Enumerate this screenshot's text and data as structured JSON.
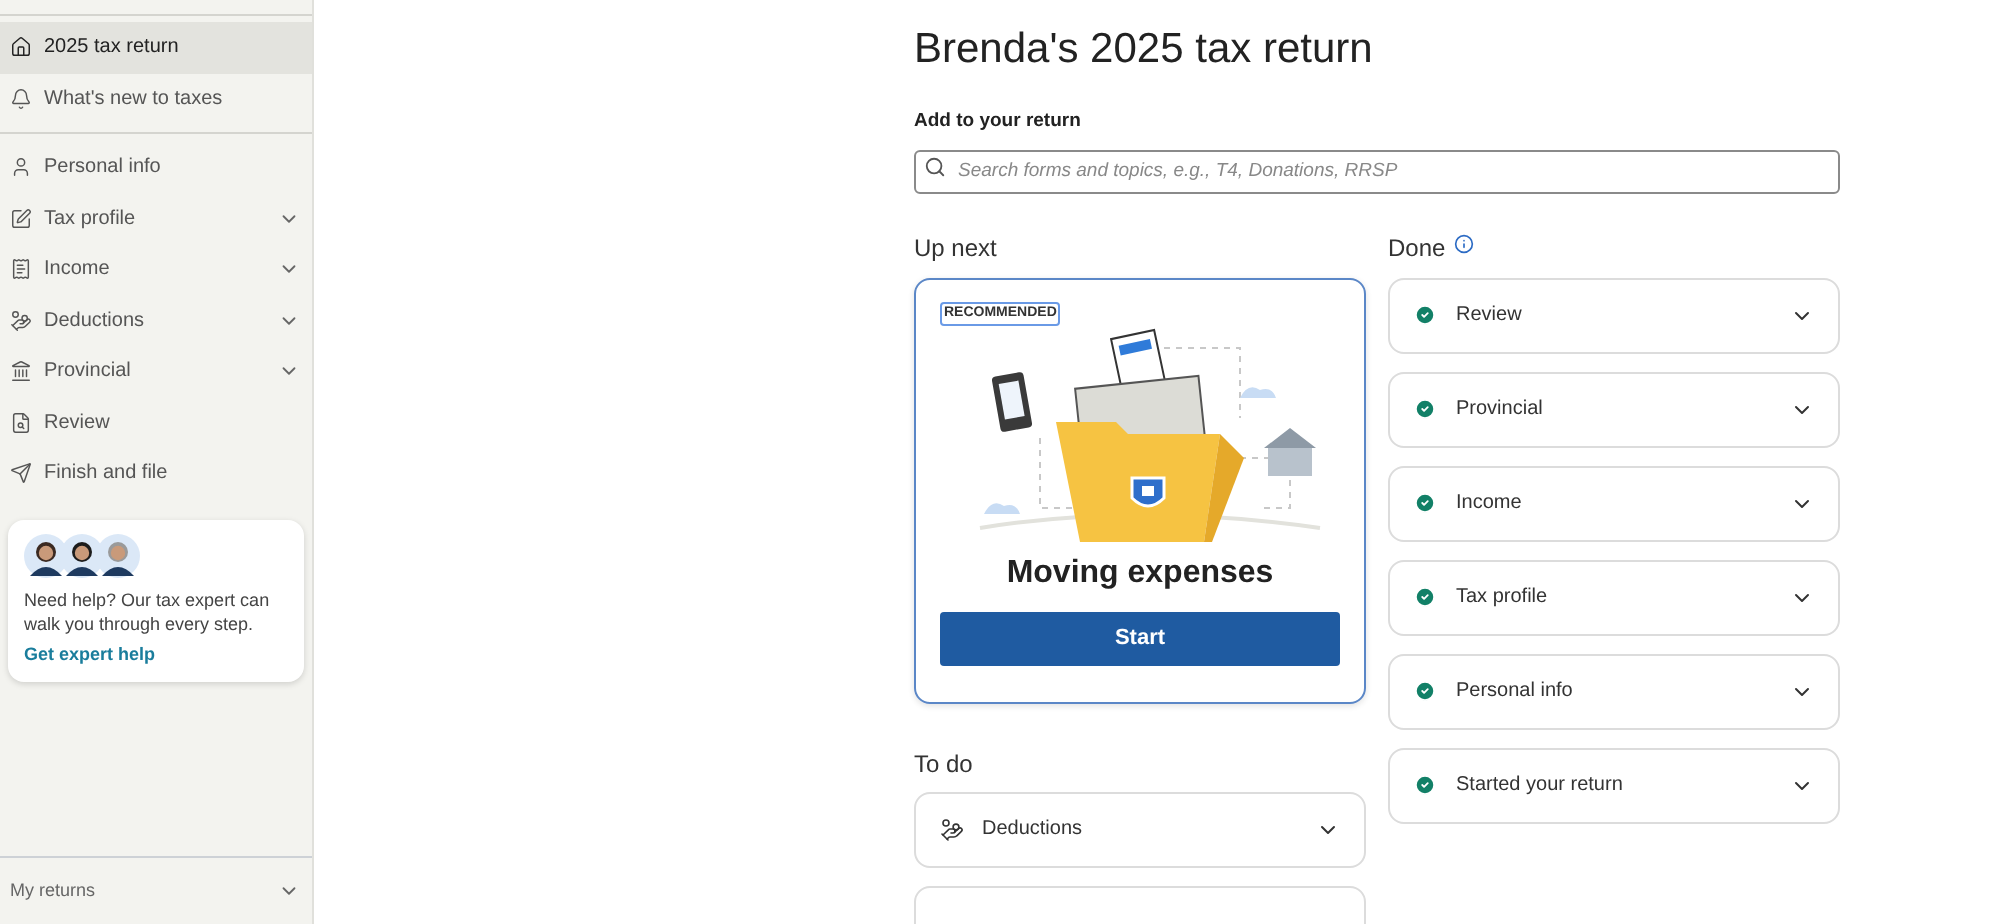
{
  "sidebar": {
    "groups": [
      [
        {
          "label": "2025 tax return",
          "kind": "home",
          "selected": true,
          "expandable": false
        },
        {
          "label": "What's new to taxes",
          "kind": "bell",
          "selected": false,
          "expandable": false
        }
      ],
      [
        {
          "label": "Personal info",
          "kind": "person",
          "selected": false,
          "expandable": false
        },
        {
          "label": "Tax profile",
          "kind": "edit",
          "selected": false,
          "expandable": true
        },
        {
          "label": "Income",
          "kind": "income",
          "selected": false,
          "expandable": true
        },
        {
          "label": "Deductions",
          "kind": "deductions",
          "selected": false,
          "expandable": true
        },
        {
          "label": "Provincial",
          "kind": "bank",
          "selected": false,
          "expandable": true
        },
        {
          "label": "Review",
          "kind": "review",
          "selected": false,
          "expandable": false
        },
        {
          "label": "Finish and file",
          "kind": "send",
          "selected": false,
          "expandable": false
        }
      ]
    ],
    "help": {
      "text": "Need help? Our tax expert can walk you through every step.",
      "link": "Get expert help"
    },
    "footer": "My returns"
  },
  "title": "Brenda's 2025 tax return",
  "search": {
    "label": "Add to your return",
    "placeholder": "Search forms and topics, e.g., T4, Donations, RRSP"
  },
  "up_next": {
    "heading": "Up next",
    "badge": "RECOMMENDED",
    "title": "Moving expenses",
    "button": "Start"
  },
  "todo": {
    "heading": "To do",
    "items": [
      {
        "label": "Deductions",
        "kind": "deductions"
      }
    ]
  },
  "done": {
    "heading": "Done",
    "items": [
      {
        "label": "Review"
      },
      {
        "label": "Provincial"
      },
      {
        "label": "Income"
      },
      {
        "label": "Tax profile"
      },
      {
        "label": "Personal info"
      },
      {
        "label": "Started your return"
      }
    ]
  }
}
